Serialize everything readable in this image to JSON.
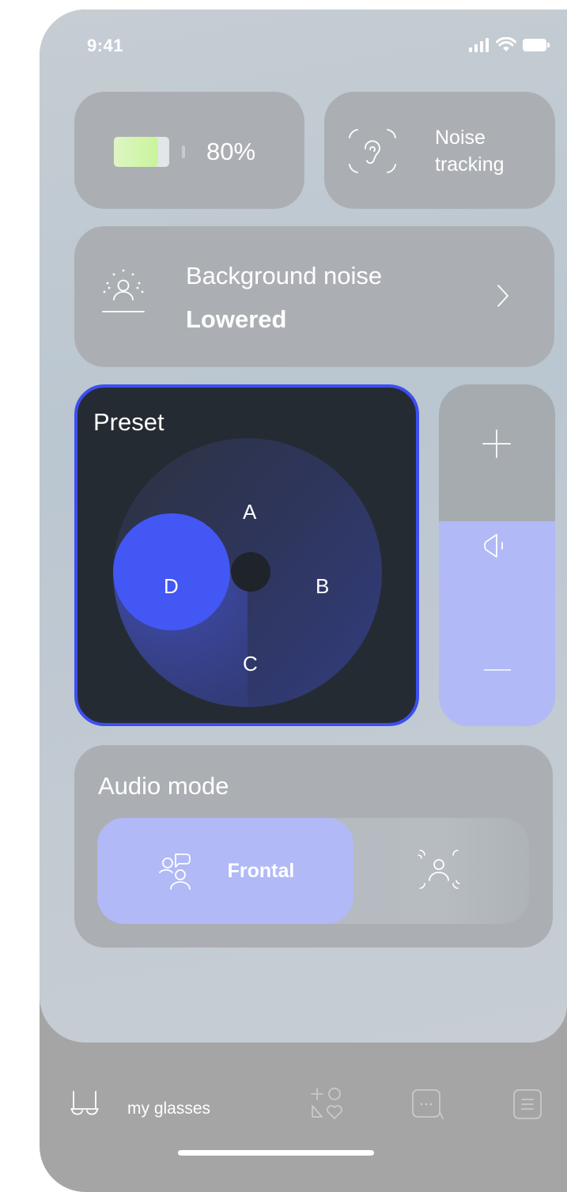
{
  "status_bar": {
    "time": "9:41"
  },
  "battery": {
    "text": "80%",
    "level": 0.8
  },
  "noise_tracking": {
    "line1": "Noise",
    "line2": "tracking"
  },
  "background_noise": {
    "title": "Background noise",
    "value": "Lowered"
  },
  "preset": {
    "title": "Preset",
    "options": [
      "A",
      "B",
      "C",
      "D"
    ],
    "selected": "D"
  },
  "volume": {
    "level": 0.6
  },
  "audio_mode": {
    "title": "Audio mode",
    "options": [
      {
        "label": "Frontal",
        "icon": "frontal-audio-icon",
        "selected": true
      },
      {
        "label": "",
        "icon": "surround-audio-icon",
        "selected": false
      }
    ]
  },
  "tabbar": {
    "items": [
      {
        "label": "my glasses",
        "icon": "glasses-icon",
        "active": true
      },
      {
        "label": "",
        "icon": "shapes-heart-icon"
      },
      {
        "label": "",
        "icon": "chat-bubble-icon"
      },
      {
        "label": "",
        "icon": "document-list-icon"
      }
    ]
  },
  "colors": {
    "accent": "#4357f5",
    "accent_light": "#b1b9f7",
    "card": "#abafb3",
    "preset_bg": "#252b33"
  }
}
